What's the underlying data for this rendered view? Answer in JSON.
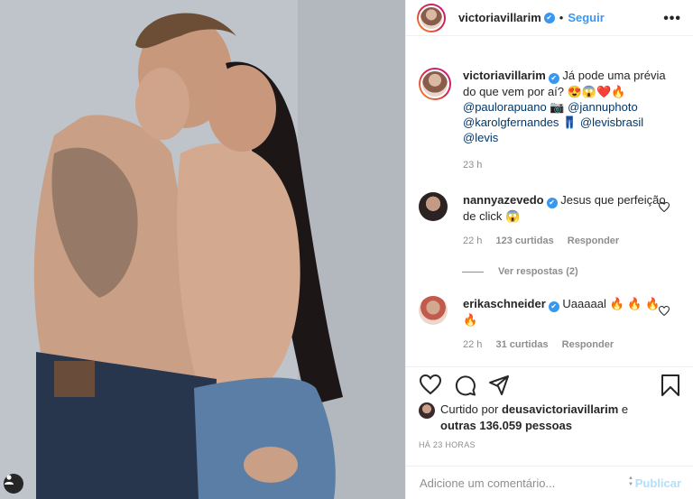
{
  "header": {
    "username": "victoriavillarim",
    "separator": "•",
    "follow_label": "Seguir",
    "more_label": "•••"
  },
  "caption": {
    "username": "victoriavillarim",
    "text_1": "Já pode uma prévia do que vem por aí? 😍😱❤️🔥",
    "mention_1": "@pauloraрuano",
    "camera_emoji": "📷",
    "mention_2": "@jannuphoto",
    "mention_3": "@karolgfernandes",
    "jeans_emoji": "👖",
    "mention_4": "@levisbrasil",
    "mention_5": "@levis",
    "time": "23 h"
  },
  "comments": [
    {
      "username": "nannyazevedo",
      "text": "Jesus que perfeição de click 😱",
      "time": "22 h",
      "likes": "123 curtidas",
      "reply_label": "Responder"
    },
    {
      "username": "erikaschneider",
      "text": "Uaaaaal 🔥 🔥 🔥🔥",
      "time": "22 h",
      "likes": "31 curtidas",
      "reply_label": "Responder"
    }
  ],
  "view_replies_label": "Ver respostas (2)",
  "likes": {
    "prefix": "Curtido por",
    "user": "deusavictoriavillarim",
    "connector": "e",
    "others": "outras 136.059 pessoas"
  },
  "timestamp": "HÁ 23 HORAS",
  "add_comment": {
    "placeholder": "Adicione um comentário...",
    "publish_label": "Publicar"
  },
  "icons": {
    "like": "heart-icon",
    "comment": "comment-icon",
    "share": "share-icon",
    "save": "bookmark-icon",
    "tag": "user-tag-icon"
  },
  "colors": {
    "accent": "#3897f0",
    "mention": "#00376b",
    "muted": "#8e8e8e",
    "publish_disabled": "#b2dffc"
  }
}
